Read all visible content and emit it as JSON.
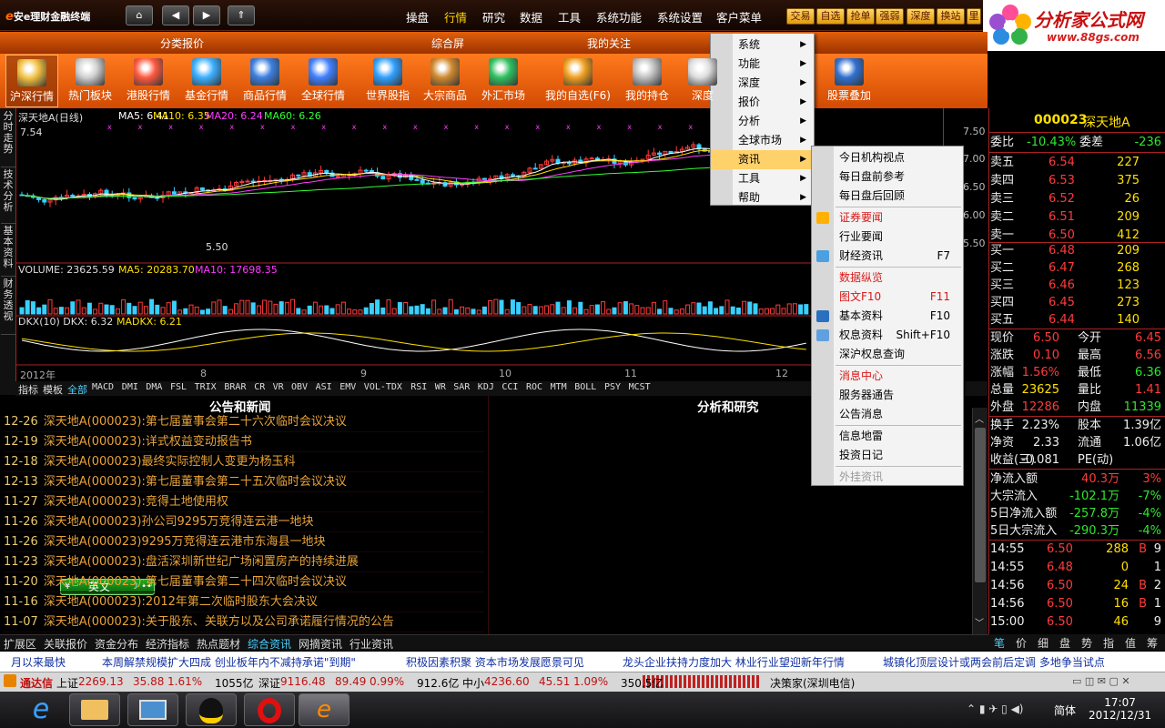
{
  "app": {
    "brand_e": "e",
    "title": "安e理财金融终端"
  },
  "nav": {
    "home": "⌂",
    "back": "◀",
    "forward": "▶",
    "up": "⇑"
  },
  "top_menu": [
    "操盘",
    "行情",
    "研究",
    "数据",
    "工具",
    "系统功能",
    "系统设置",
    "客户菜单"
  ],
  "top_menu_active": "行情",
  "trade_buttons": [
    "交易",
    "自选",
    "抢单",
    "强弱",
    "深度",
    "换站",
    "里"
  ],
  "logo": {
    "text": "分析家公式网",
    "url": "www.88gs.com"
  },
  "categories": [
    "分类报价",
    "综合屏",
    "我的关注"
  ],
  "toolbar": [
    "沪深行情",
    "热门板块",
    "港股行情",
    "基金行情",
    "商品行情",
    "全球行情",
    "世界股指",
    "大宗商品",
    "外汇市场",
    "我的自选(F6)",
    "我的持仓",
    "深度",
    "股票叠加"
  ],
  "vertical_tabs": [
    "分时走势",
    "技术分析",
    "基本资料",
    "财务透视"
  ],
  "kline": {
    "title": "深天地A(日线)",
    "ma5": "MA5: 6.41",
    "ma10": "MA10: 6.35",
    "ma20": "MA20: 6.24",
    "ma60": "MA60: 6.26",
    "high_label": "7.54",
    "low_label": "5.50",
    "y_ticks": [
      "7.50",
      "7.00",
      "6.50",
      "6.00",
      "5.50"
    ]
  },
  "volume": {
    "label": "VOLUME: 23625.59",
    "ma5": "MA5: 20283.70",
    "ma10": "MA10: 17698.35"
  },
  "dkx": {
    "label": "DKX(10) DKX: 6.32",
    "madkx": "MADKX: 6.21"
  },
  "time_axis": [
    "2012年",
    "8",
    "9",
    "10",
    "11",
    "12"
  ],
  "indicator_tabs": [
    "指标",
    "模板",
    "全部",
    "MACD",
    "DMI",
    "DMA",
    "FSL",
    "TRIX",
    "BRAR",
    "CR",
    "VR",
    "OBV",
    "ASI",
    "EMV",
    "VOL-TDX",
    "RSI",
    "WR",
    "SAR",
    "KDJ",
    "CCI",
    "ROC",
    "MTM",
    "BOLL",
    "PSY",
    "MCST"
  ],
  "news": {
    "header": "公告和新闻",
    "items": [
      {
        "date": "12-26",
        "title": "深天地A(000023):第七届董事会第二十六次临时会议决议"
      },
      {
        "date": "12-19",
        "title": "深天地A(000023):详式权益变动报告书"
      },
      {
        "date": "12-18",
        "title": "深天地A(000023)最终实际控制人变更为杨玉科"
      },
      {
        "date": "12-13",
        "title": "深天地A(000023):第七届董事会第二十五次临时会议决议"
      },
      {
        "date": "11-27",
        "title": "深天地A(000023):竞得土地使用权"
      },
      {
        "date": "11-26",
        "title": "深天地A(000023)孙公司9295万竞得连云港一地块"
      },
      {
        "date": "11-26",
        "title": "深天地A(000023)9295万竞得连云港市东海县一地块"
      },
      {
        "date": "11-23",
        "title": "深天地A(000023):盘活深圳新世纪广场闲置房产的持续进展"
      },
      {
        "date": "11-20",
        "title": "深天地A(000023):第七届董事会第二十四次临时会议决议"
      },
      {
        "date": "11-16",
        "title": "深天地A(000023):2012年第二次临时股东大会决议"
      },
      {
        "date": "11-07",
        "title": "深天地A(000023):关于股东、关联方以及公司承诺履行情况的公告"
      }
    ]
  },
  "research": {
    "header": "分析和研究"
  },
  "ime": {
    "label": "英文"
  },
  "quote": {
    "code": "000023",
    "name": "深天地A",
    "weibi_label": "委比",
    "weibi": "-10.43%",
    "weicha_label": "委差",
    "weicha": "-236",
    "asks": [
      {
        "label": "卖五",
        "price": "6.54",
        "vol": "227"
      },
      {
        "label": "卖四",
        "price": "6.53",
        "vol": "375"
      },
      {
        "label": "卖三",
        "price": "6.52",
        "vol": "26"
      },
      {
        "label": "卖二",
        "price": "6.51",
        "vol": "209"
      },
      {
        "label": "卖一",
        "price": "6.50",
        "vol": "412"
      }
    ],
    "bids": [
      {
        "label": "买一",
        "price": "6.48",
        "vol": "209"
      },
      {
        "label": "买二",
        "price": "6.47",
        "vol": "268"
      },
      {
        "label": "买三",
        "price": "6.46",
        "vol": "123"
      },
      {
        "label": "买四",
        "price": "6.45",
        "vol": "273"
      },
      {
        "label": "买五",
        "price": "6.44",
        "vol": "140"
      }
    ],
    "stats": [
      {
        "l1": "现价",
        "v1": "6.50",
        "c1": "red",
        "l2": "今开",
        "v2": "6.45",
        "c2": "red"
      },
      {
        "l1": "涨跌",
        "v1": "0.10",
        "c1": "red",
        "l2": "最高",
        "v2": "6.56",
        "c2": "red"
      },
      {
        "l1": "涨幅",
        "v1": "1.56%",
        "c1": "red",
        "l2": "最低",
        "v2": "6.36",
        "c2": "grn"
      },
      {
        "l1": "总量",
        "v1": "23625",
        "c1": "yel",
        "l2": "量比",
        "v2": "1.41",
        "c2": "red"
      },
      {
        "l1": "外盘",
        "v1": "12286",
        "c1": "red",
        "l2": "内盘",
        "v2": "11339",
        "c2": "grn"
      }
    ],
    "stats2": [
      {
        "l1": "换手",
        "v1": "2.23%",
        "l2": "股本",
        "v2": "1.39亿"
      },
      {
        "l1": "净资",
        "v1": "2.33",
        "l2": "流通",
        "v2": "1.06亿"
      },
      {
        "l1": "收益(三)",
        "v1": "-0.081",
        "l2": "PE(动)",
        "v2": ""
      }
    ],
    "flows": [
      {
        "label": "净流入额",
        "value": "40.3万",
        "pct": "3%",
        "c": "red"
      },
      {
        "label": "大宗流入",
        "value": "-102.1万",
        "pct": "-7%",
        "c": "grn"
      },
      {
        "label": "5日净流入额",
        "value": "-257.8万",
        "pct": "-4%",
        "c": "grn"
      },
      {
        "label": "5日大宗流入",
        "value": "-290.3万",
        "pct": "-4%",
        "c": "grn"
      }
    ],
    "ticks": [
      {
        "time": "14:55",
        "price": "6.50",
        "vol": "288",
        "side": "B",
        "n": "9"
      },
      {
        "time": "14:55",
        "price": "6.48",
        "vol": "0",
        "side": "",
        "n": "1"
      },
      {
        "time": "14:56",
        "price": "6.50",
        "vol": "24",
        "side": "B",
        "n": "2"
      },
      {
        "time": "14:56",
        "price": "6.50",
        "vol": "16",
        "side": "B",
        "n": "1"
      },
      {
        "time": "15:00",
        "price": "6.50",
        "vol": "46",
        "side": "",
        "n": "9"
      }
    ],
    "tabs": [
      "笔",
      "价",
      "细",
      "盘",
      "势",
      "指",
      "值",
      "筹"
    ]
  },
  "bottom_tabs": [
    "扩展区",
    "关联报价",
    "资金分布",
    "经济指标",
    "热点题材",
    "综合资讯",
    "网摘资讯",
    "行业资讯"
  ],
  "bottom_tab_active": "综合资讯",
  "ticker": [
    "月以来最快",
    "本周解禁规模扩大四成 创业板年内不减持承诺\"到期\"",
    "积极因素积聚 资本市场发展愿景可见",
    "龙头企业扶持力度加大 林业行业望迎新年行情",
    "城镇化顶层设计或两会前后定调 多地争当试点"
  ],
  "status_bar": {
    "broker": "通达信",
    "indices": [
      {
        "name": "上证",
        "value": "2269.13",
        "chg": "35.88",
        "pct": "1.61%",
        "amt": "1055亿"
      },
      {
        "name": "深证",
        "value": "9116.48",
        "chg": "89.49",
        "pct": "0.99%",
        "amt": "912.6亿"
      },
      {
        "name": "中小",
        "value": "4236.60",
        "chg": "45.51",
        "pct": "1.09%",
        "amt": "350.5亿"
      }
    ],
    "server": "决策家(深圳电信)"
  },
  "taskbar": {
    "lang": "简体",
    "time": "17:07",
    "date": "2012/12/31"
  },
  "main_menu": {
    "items": [
      "系统",
      "功能",
      "深度",
      "报价",
      "分析",
      "全球市场",
      "资讯",
      "工具",
      "帮助"
    ],
    "highlighted": "资讯"
  },
  "sub_menu": {
    "items": [
      {
        "label": "今日机构视点",
        "shortcut": "",
        "red": false
      },
      {
        "label": "每日盘前参考",
        "shortcut": "",
        "red": false
      },
      {
        "label": "每日盘后回顾",
        "shortcut": "",
        "red": false
      },
      {
        "label": "证券要闻",
        "shortcut": "",
        "red": true
      },
      {
        "label": "行业要闻",
        "shortcut": "",
        "red": false
      },
      {
        "label": "财经资讯",
        "shortcut": "F7",
        "red": false
      },
      {
        "label": "数据纵览",
        "shortcut": "",
        "red": true
      },
      {
        "label": "图文F10",
        "shortcut": "F11",
        "red": true
      },
      {
        "label": "基本资料",
        "shortcut": "F10",
        "red": false
      },
      {
        "label": "权息资料",
        "shortcut": "Shift+F10",
        "red": false
      },
      {
        "label": "深沪权息查询",
        "shortcut": "",
        "red": false
      },
      {
        "label": "消息中心",
        "shortcut": "",
        "red": true
      },
      {
        "label": "服务器通告",
        "shortcut": "",
        "red": false
      },
      {
        "label": "公告消息",
        "shortcut": "",
        "red": false
      },
      {
        "label": "信息地雷",
        "shortcut": "",
        "red": false
      },
      {
        "label": "投资日记",
        "shortcut": "",
        "red": false
      },
      {
        "label": "外挂资讯",
        "shortcut": "",
        "red": false,
        "disabled": true
      }
    ]
  },
  "colors": {
    "accent": "#e25a06",
    "up": "#ff3b3b",
    "down": "#2ee82e",
    "menu_highlight": "#ffd16b"
  }
}
